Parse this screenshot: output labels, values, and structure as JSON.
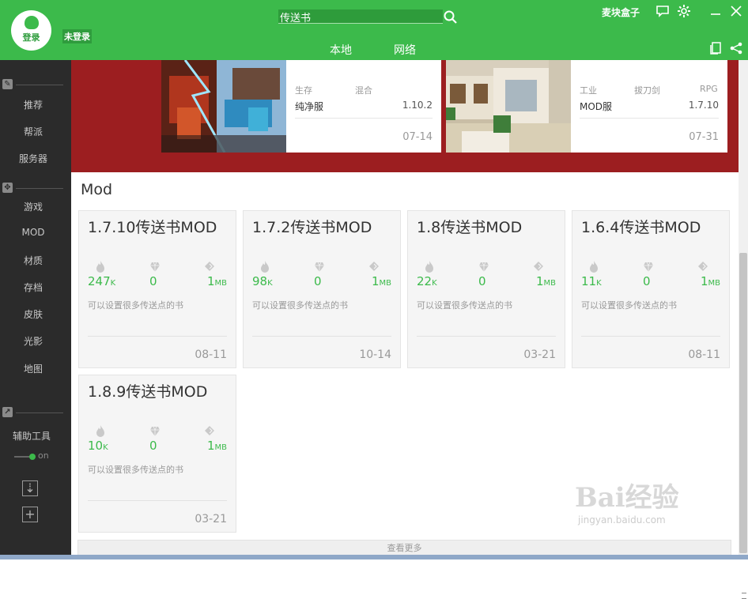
{
  "header": {
    "login_label": "登录",
    "status": "未登录",
    "search_value": "传送书",
    "brand": "麦块盒子",
    "tabs": [
      "本地",
      "网络"
    ]
  },
  "sidebar": {
    "group1": [
      "推荐",
      "帮派",
      "服务器"
    ],
    "group2": [
      "游戏",
      "MOD",
      "材质",
      "存档",
      "皮肤",
      "光影",
      "地图"
    ],
    "tools_label": "辅助工具",
    "toggle_label": "on"
  },
  "banner": {
    "cards": [
      {
        "tags": [
          "生存",
          "混合"
        ],
        "name": "纯净服",
        "version": "1.10.2",
        "date": "07-14"
      },
      {
        "tags": [
          "工业",
          "拔刀剑",
          "RPG"
        ],
        "name": "MOD服",
        "version": "1.7.10",
        "date": "07-31"
      }
    ]
  },
  "section_title": "Mod",
  "mods": [
    {
      "title": "1.7.10传送书MOD",
      "downloads": "247",
      "downloads_unit": "K",
      "gems": "0",
      "size": "1",
      "size_unit": "MB",
      "desc": "可以设置很多传送点的书",
      "date": "08-11"
    },
    {
      "title": "1.7.2传送书MOD",
      "downloads": "98",
      "downloads_unit": "K",
      "gems": "0",
      "size": "1",
      "size_unit": "MB",
      "desc": "可以设置很多传送点的书",
      "date": "10-14"
    },
    {
      "title": "1.8传送书MOD",
      "downloads": "22",
      "downloads_unit": "K",
      "gems": "0",
      "size": "1",
      "size_unit": "MB",
      "desc": "可以设置很多传送点的书",
      "date": "03-21"
    },
    {
      "title": "1.6.4传送书MOD",
      "downloads": "11",
      "downloads_unit": "K",
      "gems": "0",
      "size": "1",
      "size_unit": "MB",
      "desc": "可以设置很多传送点的书",
      "date": "08-11"
    },
    {
      "title": "1.8.9传送书MOD",
      "downloads": "10",
      "downloads_unit": "K",
      "gems": "0",
      "size": "1",
      "size_unit": "MB",
      "desc": "可以设置很多传送点的书",
      "date": "03-21"
    }
  ],
  "more_label": "查看更多",
  "watermark": {
    "brand": "Bai经验",
    "url": "jingyan.baidu.com"
  },
  "colors": {
    "accent": "#3cba4b",
    "banner": "#9c1e20",
    "sidebar": "#2b2b2b"
  }
}
